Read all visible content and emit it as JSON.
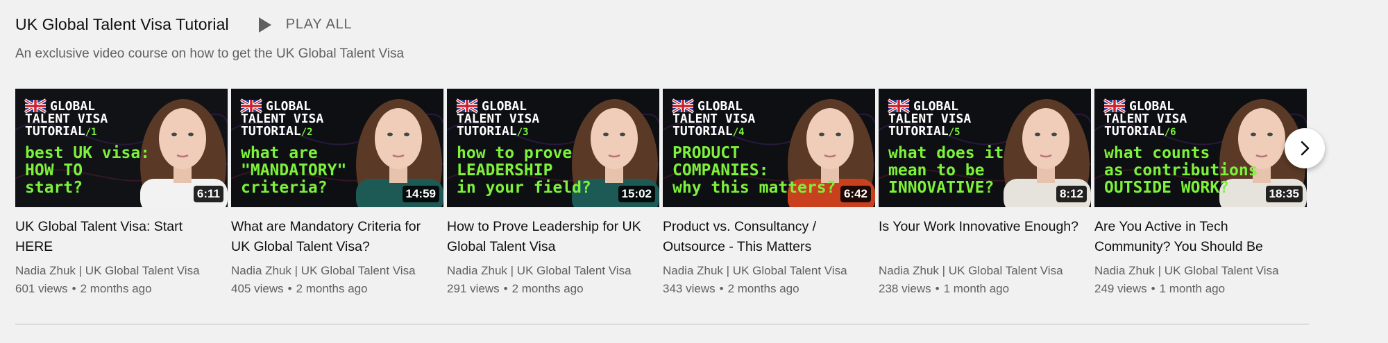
{
  "shelf": {
    "title": "UK Global Talent Visa Tutorial",
    "play_all_label": "PLAY ALL",
    "description": "An exclusive video course on how to get the UK Global Talent Visa"
  },
  "videos": [
    {
      "title": "UK Global Talent Visa: Start HERE",
      "channel": "Nadia Zhuk | UK Global Talent Visa",
      "views": "601 views",
      "age": "2 months ago",
      "duration": "6:11",
      "thumb_header": [
        "GLOBAL",
        "TALENT VISA",
        "TUTORIAL"
      ],
      "thumb_num": "/1",
      "thumb_caption": [
        "best UK visa:",
        "HOW TO",
        "start?"
      ],
      "bg_color": "#111216",
      "shirt_color": "#f2f2f2"
    },
    {
      "title": "What are Mandatory Criteria for UK Global Talent Visa?",
      "channel": "Nadia Zhuk | UK Global Talent Visa",
      "views": "405 views",
      "age": "2 months ago",
      "duration": "14:59",
      "thumb_header": [
        "GLOBAL",
        "TALENT VISA",
        "TUTORIAL"
      ],
      "thumb_num": "/2",
      "thumb_caption": [
        "what are",
        "\"MANDATORY\"",
        "criteria?"
      ],
      "bg_color": "#0e0f12",
      "shirt_color": "#1e5a55"
    },
    {
      "title": "How to Prove Leadership for UK Global Talent Visa",
      "channel": "Nadia Zhuk | UK Global Talent Visa",
      "views": "291 views",
      "age": "2 months ago",
      "duration": "15:02",
      "thumb_header": [
        "GLOBAL",
        "TALENT VISA",
        "TUTORIAL"
      ],
      "thumb_num": "/3",
      "thumb_caption": [
        "how to prove",
        "LEADERSHIP",
        "in your field?"
      ],
      "bg_color": "#0e0f12",
      "shirt_color": "#1e5a55"
    },
    {
      "title": "Product vs. Consultancy / Outsource - This Matters",
      "channel": "Nadia Zhuk | UK Global Talent Visa",
      "views": "343 views",
      "age": "2 months ago",
      "duration": "6:42",
      "thumb_header": [
        "GLOBAL",
        "TALENT VISA",
        "TUTORIAL"
      ],
      "thumb_num": "/4",
      "thumb_caption": [
        "PRODUCT",
        "COMPANIES:",
        "why this matters?"
      ],
      "bg_color": "#0e0f12",
      "shirt_color": "#c9401f"
    },
    {
      "title": "Is Your Work Innovative Enough?",
      "channel": "Nadia Zhuk | UK Global Talent Visa",
      "views": "238 views",
      "age": "1 month ago",
      "duration": "8:12",
      "thumb_header": [
        "GLOBAL",
        "TALENT VISA",
        "TUTORIAL"
      ],
      "thumb_num": "/5",
      "thumb_caption": [
        "what does it",
        "mean to be",
        "INNOVATIVE?"
      ],
      "bg_color": "#0e0f12",
      "shirt_color": "#e6e3dc"
    },
    {
      "title": "Are You Active in Tech Community? You Should Be",
      "channel": "Nadia Zhuk | UK Global Talent Visa",
      "views": "249 views",
      "age": "1 month ago",
      "duration": "18:35",
      "thumb_header": [
        "GLOBAL",
        "TALENT VISA",
        "TUTORIAL"
      ],
      "thumb_num": "/6",
      "thumb_caption": [
        "what counts",
        "as contributions",
        "OUTSIDE WORK?"
      ],
      "bg_color": "#0e0f12",
      "shirt_color": "#e6e3dc"
    }
  ],
  "meta_separator": "•",
  "colors": {
    "background": "#f1f1f1",
    "thumb_green": "#7cf23a",
    "secondary_text": "#606060",
    "primary_text": "#0f0f0f"
  },
  "icons": {
    "play_all": "play-icon",
    "next": "chevron-right-icon",
    "flag": "uk-flag-icon"
  }
}
